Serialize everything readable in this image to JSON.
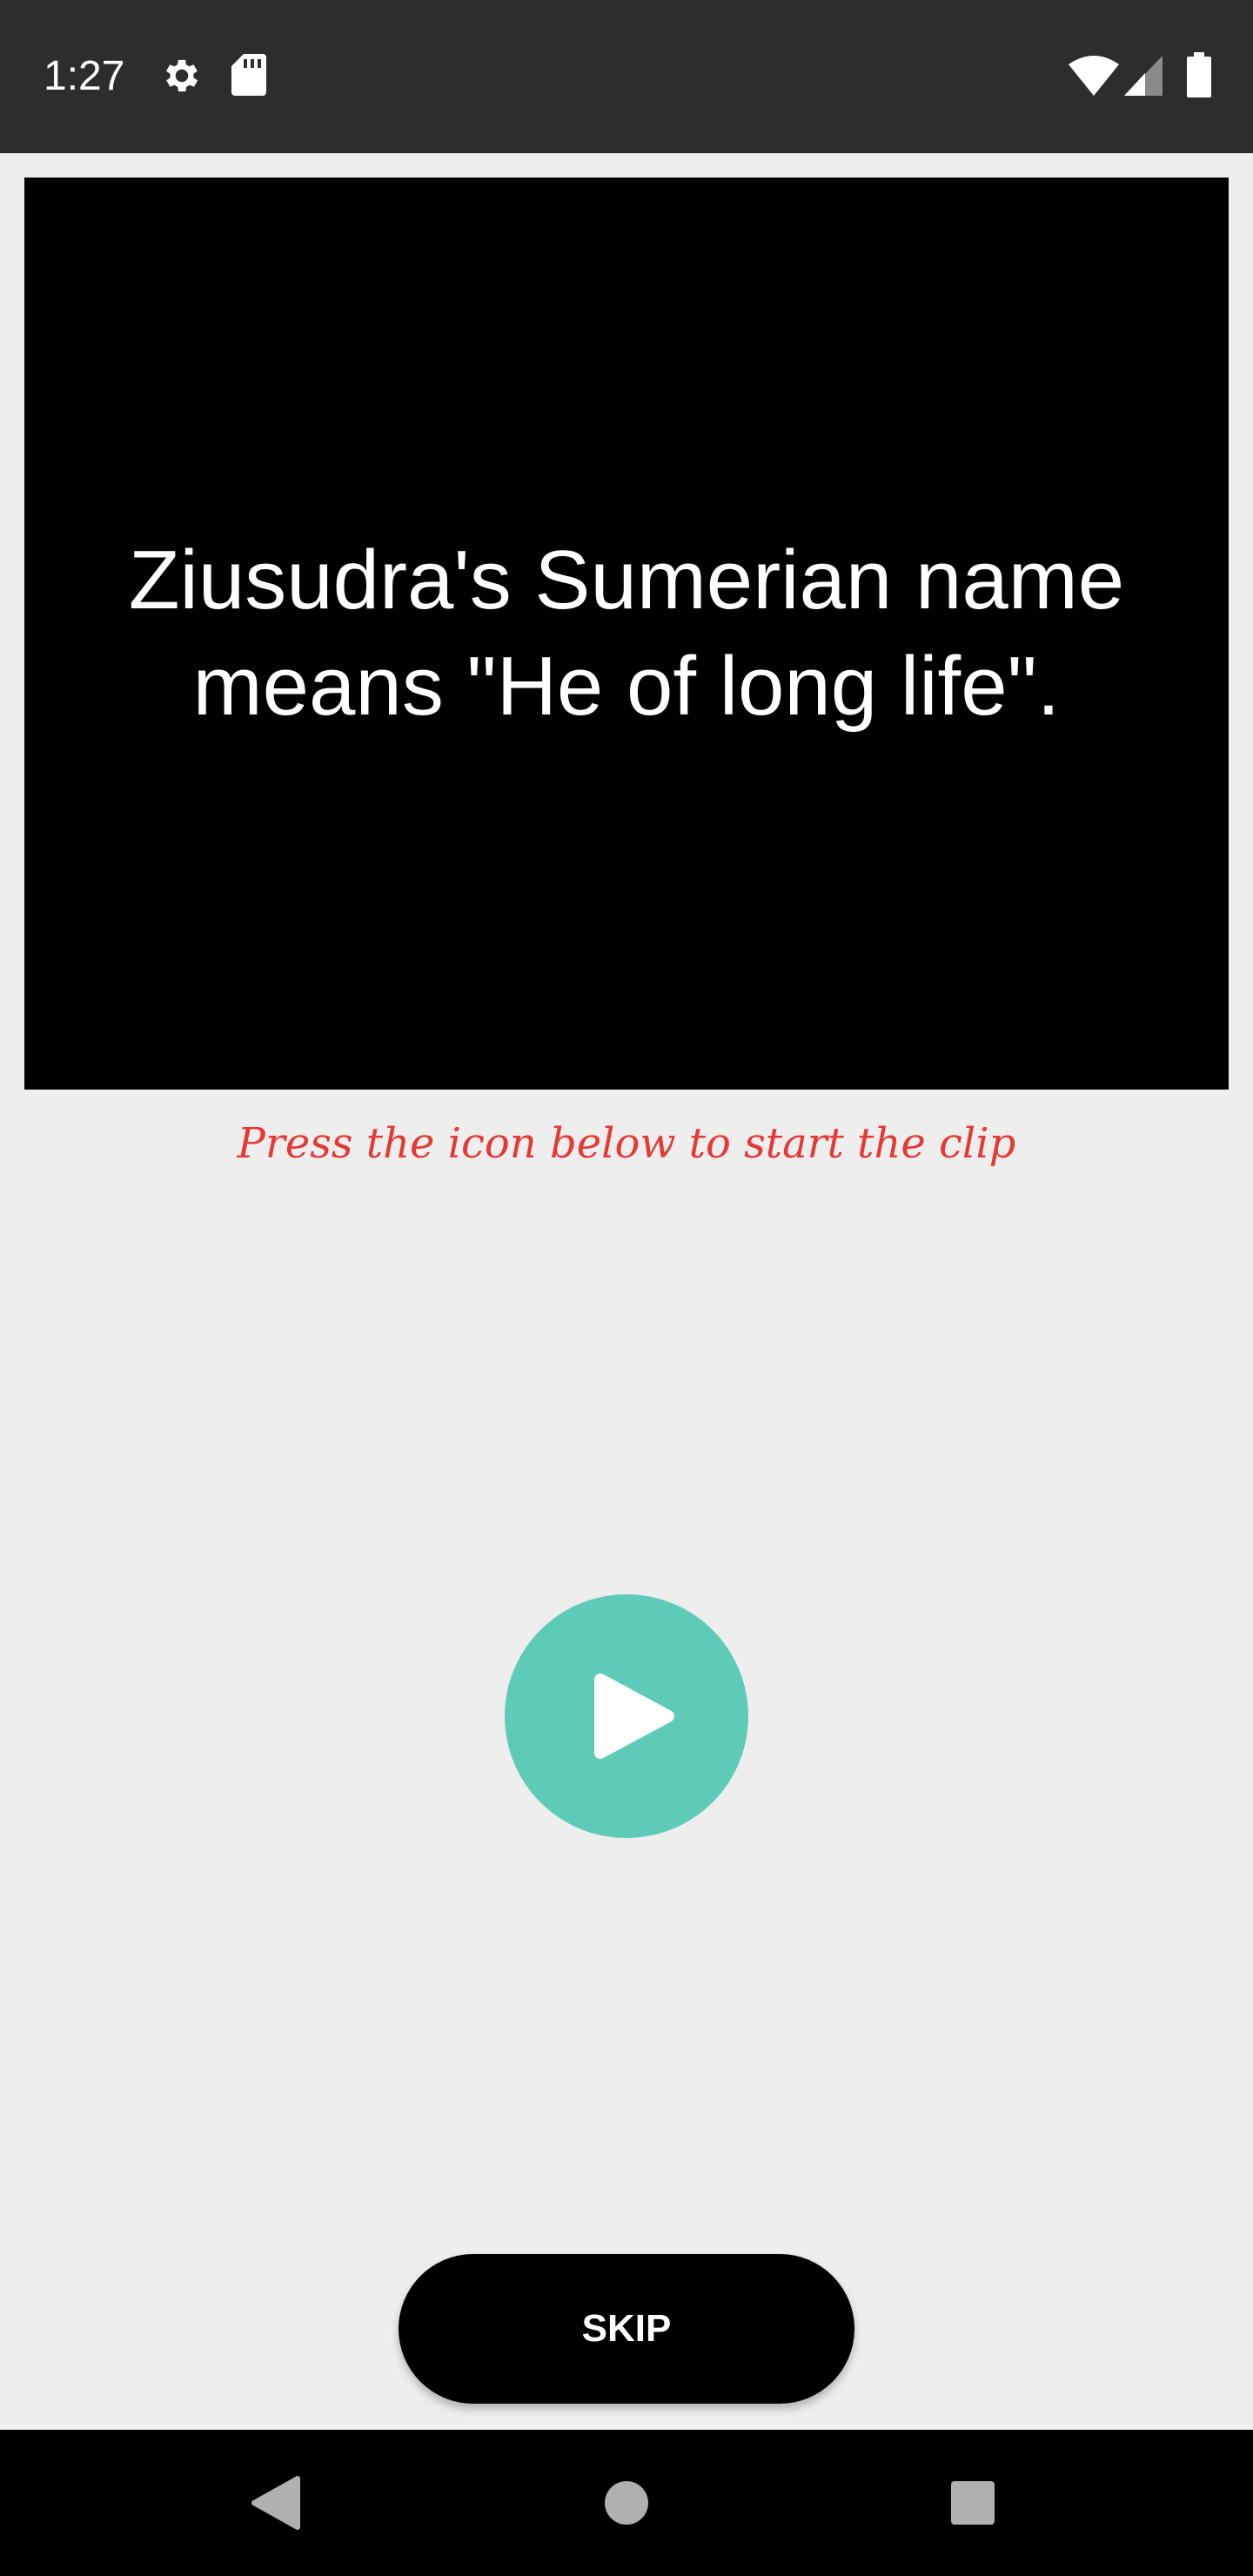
{
  "status_bar": {
    "time": "1:27",
    "icons": [
      "gear-icon",
      "sd-card-icon",
      "wifi-icon",
      "cell-signal-icon",
      "battery-icon"
    ],
    "background": "#2d2d2d"
  },
  "video": {
    "fact_text": "Ziusudra's Sumerian name means \"He of long life\".",
    "background": "#000000"
  },
  "hint": {
    "text": "Press the icon below to start the clip",
    "color": "#e53935"
  },
  "play_button": {
    "icon": "play-icon",
    "color": "#5ecbb8"
  },
  "skip_button": {
    "label": "SKIP"
  },
  "nav_bar": {
    "icons": [
      "back-icon",
      "home-icon",
      "recents-icon"
    ]
  }
}
